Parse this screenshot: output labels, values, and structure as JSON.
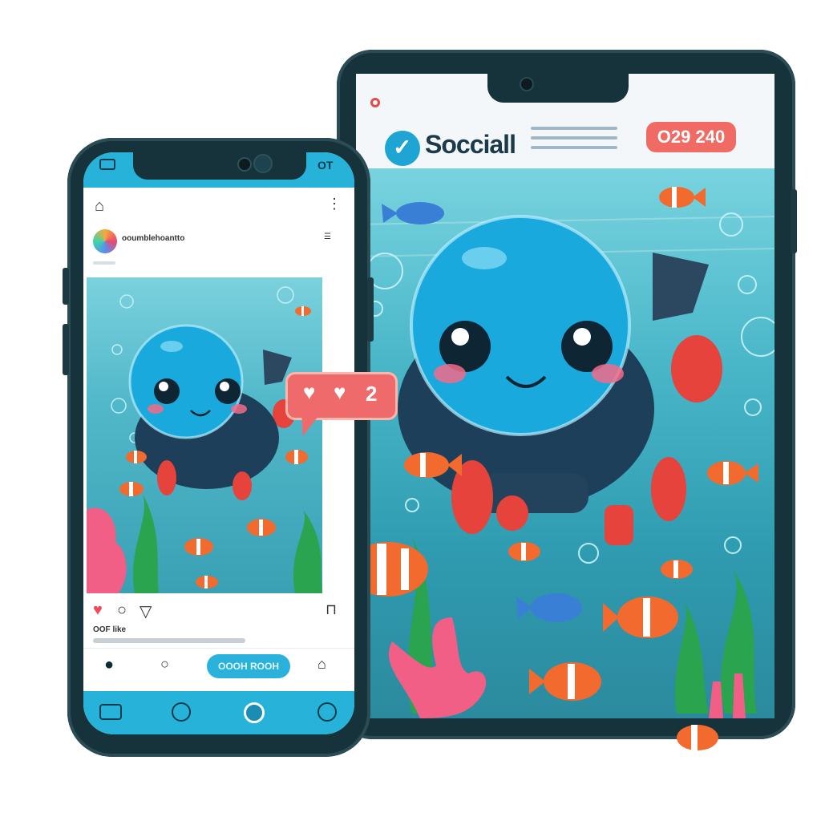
{
  "tablet": {
    "brand": "Socciall",
    "badge": "O29 240"
  },
  "phone": {
    "status_right": "OT",
    "username": "ooumblehoantto",
    "likes_text": "OOF like",
    "follow_button": "OOOH ROOH",
    "like_count": "2"
  },
  "colors": {
    "accent": "#27b3d9",
    "badge": "#ef6b63",
    "frame": "#16323b"
  }
}
